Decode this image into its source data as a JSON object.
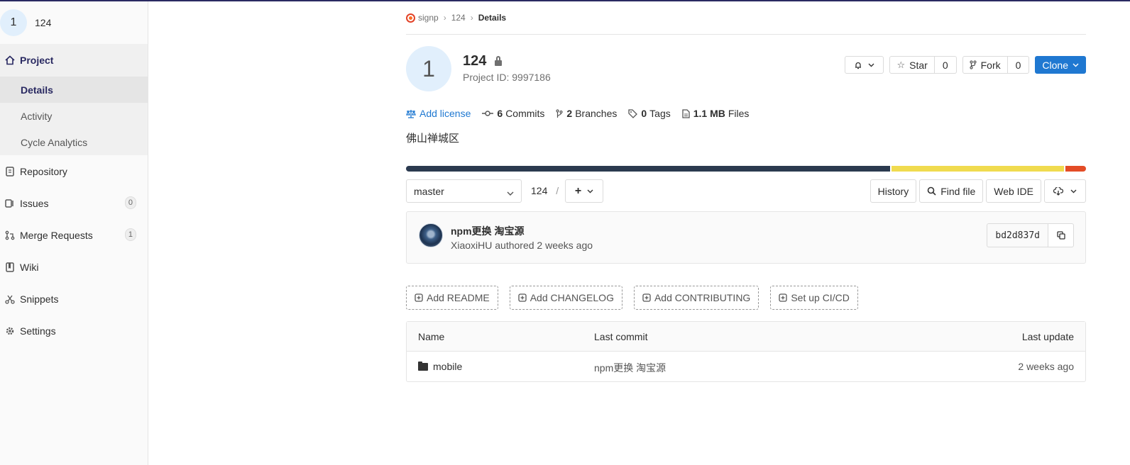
{
  "sidebar": {
    "avatar_letter": "1",
    "project_name": "124",
    "items": [
      {
        "label": "Project"
      },
      {
        "label": "Repository"
      },
      {
        "label": "Issues",
        "count": "0"
      },
      {
        "label": "Merge Requests",
        "count": "1"
      },
      {
        "label": "Wiki"
      },
      {
        "label": "Snippets"
      },
      {
        "label": "Settings"
      }
    ],
    "subitems": [
      {
        "label": "Details"
      },
      {
        "label": "Activity"
      },
      {
        "label": "Cycle Analytics"
      }
    ]
  },
  "breadcrumb": {
    "group": "signp",
    "project": "124",
    "current": "Details"
  },
  "project": {
    "avatar_letter": "1",
    "title": "124",
    "id_text": "Project ID: 9997186",
    "description": "佛山禅城区"
  },
  "actions": {
    "star_label": "Star",
    "star_count": "0",
    "fork_label": "Fork",
    "fork_count": "0",
    "clone_label": "Clone"
  },
  "stats": {
    "add_license": "Add license",
    "commits_count": "6",
    "commits_label": "Commits",
    "branches_count": "2",
    "branches_label": "Branches",
    "tags_count": "0",
    "tags_label": "Tags",
    "files_size": "1.1 MB",
    "files_label": "Files"
  },
  "language_bar": [
    {
      "color": "#2b3a4f",
      "percent": 71.5
    },
    {
      "color": "#f0db4f",
      "percent": 25.5
    },
    {
      "color": "#e34c26",
      "percent": 3.0
    }
  ],
  "tree": {
    "branch": "master",
    "path": "124",
    "path_sep": "/",
    "history": "History",
    "find_file": "Find file",
    "web_ide": "Web IDE"
  },
  "commit": {
    "title": "npm更换 淘宝源",
    "author": "XiaoxiHU",
    "meta_suffix": "authored 2 weeks ago",
    "sha": "bd2d837d"
  },
  "quick_actions": [
    {
      "label": "Add README"
    },
    {
      "label": "Add CHANGELOG"
    },
    {
      "label": "Add CONTRIBUTING"
    },
    {
      "label": "Set up CI/CD"
    }
  ],
  "files": {
    "headers": {
      "name": "Name",
      "last_commit": "Last commit",
      "last_update": "Last update"
    },
    "rows": [
      {
        "name": "mobile",
        "last_commit": "npm更换 淘宝源",
        "last_update": "2 weeks ago"
      }
    ]
  }
}
